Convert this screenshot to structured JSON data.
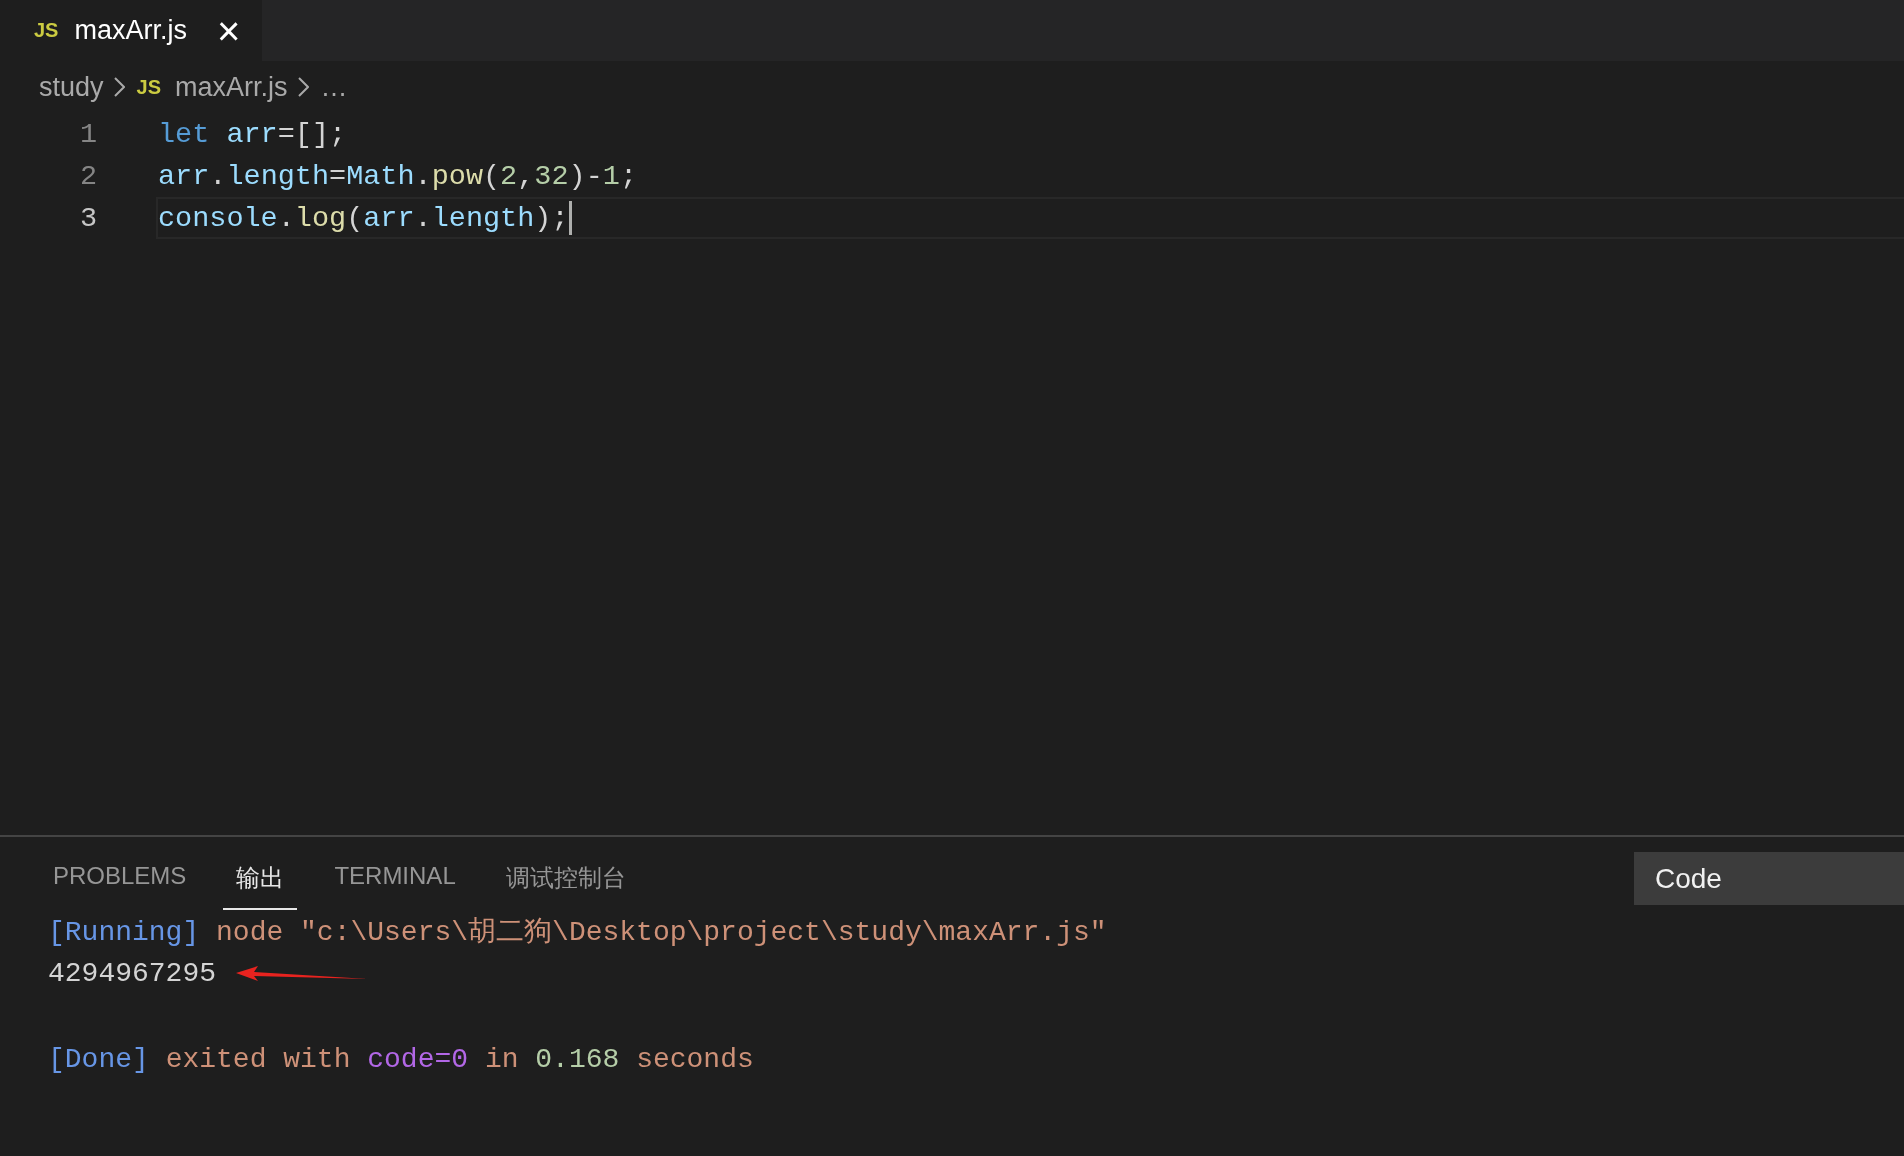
{
  "tabs": [
    {
      "icon": "JS",
      "label": "maxArr.js",
      "close": "×",
      "selected": true
    }
  ],
  "breadcrumb": [
    {
      "label": "study"
    },
    {
      "label": "maxArr.js",
      "icon": "JS"
    },
    {
      "label": "…"
    }
  ],
  "editor": {
    "lines": [
      {
        "number": "1",
        "current": false,
        "tokens": [
          {
            "kind": "keyword",
            "text": "let"
          },
          {
            "kind": "variable",
            "text": " arr"
          },
          {
            "kind": "plain",
            "text": "=[];"
          }
        ]
      },
      {
        "number": "2",
        "current": false,
        "tokens": [
          {
            "kind": "variable",
            "text": "arr"
          },
          {
            "kind": "plain",
            "text": "."
          },
          {
            "kind": "variable",
            "text": "length"
          },
          {
            "kind": "plain",
            "text": "="
          },
          {
            "kind": "variable",
            "text": "Math"
          },
          {
            "kind": "plain",
            "text": "."
          },
          {
            "kind": "function",
            "text": "pow"
          },
          {
            "kind": "plain",
            "text": "("
          },
          {
            "kind": "number",
            "text": "2"
          },
          {
            "kind": "plain",
            "text": ","
          },
          {
            "kind": "number",
            "text": "32"
          },
          {
            "kind": "plain",
            "text": ")-"
          },
          {
            "kind": "number",
            "text": "1"
          },
          {
            "kind": "plain",
            "text": ";"
          }
        ]
      },
      {
        "number": "3",
        "current": true,
        "tokens": [
          {
            "kind": "variable",
            "text": "console"
          },
          {
            "kind": "plain",
            "text": "."
          },
          {
            "kind": "function",
            "text": "log"
          },
          {
            "kind": "plain",
            "text": "("
          },
          {
            "kind": "variable",
            "text": "arr"
          },
          {
            "kind": "plain",
            "text": "."
          },
          {
            "kind": "variable",
            "text": "length"
          },
          {
            "kind": "plain",
            "text": ");"
          }
        ]
      }
    ]
  },
  "panel": {
    "tabs": [
      {
        "label": "PROBLEMS",
        "selected": false
      },
      {
        "label": "输出",
        "selected": true
      },
      {
        "label": "TERMINAL",
        "selected": false
      },
      {
        "label": "调试控制台",
        "selected": false
      }
    ],
    "channel": "Code",
    "output": [
      {
        "kind": "text",
        "tokens": [
          {
            "kind": "tag",
            "text": "[Running]"
          },
          {
            "kind": "string",
            "text": " node \"c:\\Users\\胡二狗\\Desktop\\project\\study\\maxArr.js\""
          }
        ]
      },
      {
        "kind": "text",
        "arrow": true,
        "tokens": [
          {
            "kind": "plain",
            "text": "4294967295"
          }
        ]
      },
      {
        "kind": "blank"
      },
      {
        "kind": "text",
        "tokens": [
          {
            "kind": "tag",
            "text": "[Done]"
          },
          {
            "kind": "string",
            "text": " exited with "
          },
          {
            "kind": "keyword",
            "text": "code=0"
          },
          {
            "kind": "string",
            "text": " in "
          },
          {
            "kind": "number",
            "text": "0.168"
          },
          {
            "kind": "string",
            "text": " seconds"
          }
        ]
      }
    ]
  }
}
